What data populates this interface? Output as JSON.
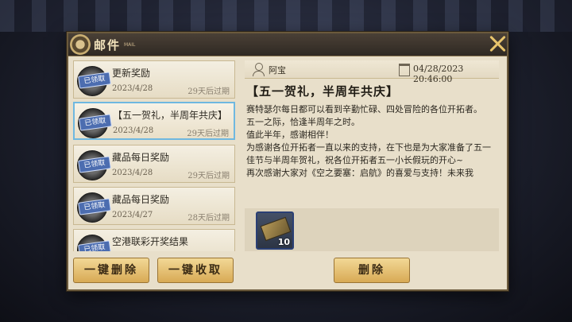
{
  "window": {
    "title": "邮件",
    "subtitle": "MAIL"
  },
  "mail_list": [
    {
      "title": "更新奖励",
      "date": "2023/4/28",
      "expire": "29天后过期",
      "status": "已领取"
    },
    {
      "title": "【五一贺礼，半周年共庆】",
      "date": "2023/4/28",
      "expire": "29天后过期",
      "status": "已领取"
    },
    {
      "title": "藏品每日奖励",
      "date": "2023/4/28",
      "expire": "29天后过期",
      "status": "已领取"
    },
    {
      "title": "藏品每日奖励",
      "date": "2023/4/27",
      "expire": "28天后过期",
      "status": "已领取"
    },
    {
      "title": "空港联彩开奖结果",
      "date": "",
      "expire": "",
      "status": "已领取"
    }
  ],
  "buttons": {
    "delete_all": "一键删除",
    "claim_all": "一键收取",
    "delete": "删除"
  },
  "detail": {
    "sender": "阿宝",
    "time": "04/28/2023 20:46:00",
    "title": "【五一贺礼，半周年共庆】",
    "body": [
      "赛特瑟尔每日都可以看到辛勤忙碌、四处冒险的各位开拓者。",
      "五一之际，恰逢半周年之时。",
      "值此半年，感谢相伴！",
      "为感谢各位开拓者一直以来的支持，在下也是为大家准备了五一佳节与半周年贺礼，祝各位开拓者五一小长假玩的开心~",
      "再次感谢大家对《空之要塞：启航》的喜爱与支持！未来我"
    ],
    "attachment": {
      "name": "item-scroll",
      "count": "10"
    }
  },
  "colors": {
    "accent_gold": "#e8c46c",
    "selected_border": "#6fb8e0",
    "claimed_tag": "#4c6db0"
  }
}
